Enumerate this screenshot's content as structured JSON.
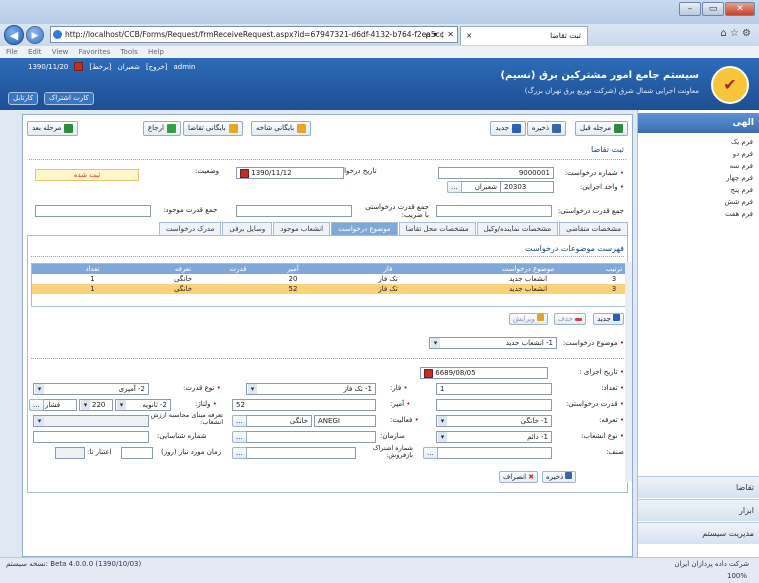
{
  "browser": {
    "url": "http://localhost/CCB/Forms/Request/frmReceiveRequest.aspx?id=67947321-d6df-4132-b764-f2ea5c",
    "url_controls": "ρ ▾ ¢ ✕",
    "tab_title": "ثبت تقاضا",
    "tab_close": "×",
    "menu": [
      "File",
      "Edit",
      "View",
      "Favorites",
      "Tools",
      "Help"
    ],
    "tools_icons": "⌂ ☆ ⚙",
    "zoom": "100%",
    "win_min": "–",
    "win_max": "▭",
    "win_close": "✕",
    "back": "◀",
    "fwd": "▶"
  },
  "app": {
    "title": "سیستم جامع امور مشترکین برق (نسیم)",
    "subtitle": "معاونت اجرایی شمال شرق (شرکت توزیع برق تهران بزرگ)",
    "date": "1390/11/20",
    "links": [
      "[برخط]",
      "شعبران",
      "[خروج]",
      "admin"
    ],
    "cartable": "کارتابل",
    "subscriber_card": "کارت اشتراک",
    "logo_text": "✔"
  },
  "toolbar": {
    "prev_step": "مرحله قبل",
    "save": "ذخیره",
    "new": "جدید",
    "archive_branch": "بایگانی شاخه",
    "archive_request": "بایگانی تقاضا",
    "return": "ارجاع",
    "next_step": "مرحله بعد"
  },
  "form": {
    "section_title": "ثبت تقاضا",
    "request_no_label": "شماره درخواست:",
    "request_no": "9000001",
    "request_date_label": "تاریخ درخواست:",
    "request_date": "1390/11/12",
    "status_label": "وضعیت:",
    "status": "ثبت شده",
    "exec_unit_label": "واحد اجرایی:",
    "exec_unit_code": "20303",
    "exec_unit_name": "شعبران",
    "applicant_power_label": "جمع قدرت درخواستی:",
    "applicant_power_coef_label": "جمع قدرت درخواستی با ضریب:",
    "existing_power_label": "جمع قدرت موجود:",
    "lookup_btn": "..."
  },
  "tabs": [
    "مشخصات متقاضی",
    "مشخصات نماینده/وکیل",
    "مشخصات محل تقاضا",
    "موضوع درخواست",
    "انشعاب موجود",
    "وسایل برقی",
    "مدرک درخواست"
  ],
  "grid": {
    "title": "فهرست موضوعات درخواست",
    "headers": [
      "ترتیب",
      "موضوع درخواست",
      "فاز",
      "آمپر",
      "قدرت",
      "تعرفه",
      "تعداد"
    ],
    "rows": [
      [
        "3",
        "انشعاب جدید",
        "تک فاز",
        "20",
        "",
        "خانگی",
        "1"
      ],
      [
        "3",
        "انشعاب جدید",
        "تک فاز",
        "52",
        "",
        "خانگی",
        "1"
      ]
    ],
    "new_btn": "جدید",
    "delete_btn": "حذف",
    "edit_btn": "ویرایش"
  },
  "detail": {
    "subject_label": "موضوع درخواست:",
    "subject_value": "1- انشعاب جدید",
    "exec_date_label": "تاریخ اجرای :",
    "exec_date": "6689/08/05",
    "count_label": "تعداد:",
    "count": "1",
    "phase_label": "فاز:",
    "phase": "1- تک فاز",
    "power_type_label": "نوع قدرت:",
    "power_type": "2- آمپری",
    "req_power_label": "قدرت درخواستی:",
    "amp_label": "آمپر:",
    "amp": "52",
    "voltage_label": "ولتاژ:",
    "voltage_code": "220",
    "voltage_phase": "فشار",
    "voltage_type": "2- ثانویه",
    "tariff_label": "تعرفه:",
    "tariff": "1- خانگی",
    "activity_label": "فعالیت:",
    "activity_code": "ANEGI",
    "activity": "خانگی",
    "tariff_calc_label": "تعرفه مبنای محاسبه ارزش انشعاب:",
    "branch_type_label": "نوع انشعاب:",
    "branch_type": "1- دائم",
    "org_label": "سازمان:",
    "id_no_label": "شماره شناسایی:",
    "sub_no_label": "شماره اشتراک بازفروش:",
    "need_time_label": "زمان مورد نیاز (روز)",
    "credit_label": "اعتبار تا:",
    "class_label": "صنف:",
    "save_btn": "ذخیره",
    "cancel_btn": "انصراف"
  },
  "sidebar": {
    "title": "الهی",
    "items": [
      "فرم یک",
      "فرم دو",
      "فرم سه",
      "فرم چهار",
      "فرم پنج",
      "فرم شش",
      "فرم هفت"
    ],
    "bottom": [
      "تقاضا",
      "ابزار",
      "مدیریت سیستم"
    ]
  },
  "footer": {
    "version": "(1390/10/03) 4.0.0.0 Beta :نسخه سیستم",
    "company": "شرکت داده پردازان ایران"
  }
}
